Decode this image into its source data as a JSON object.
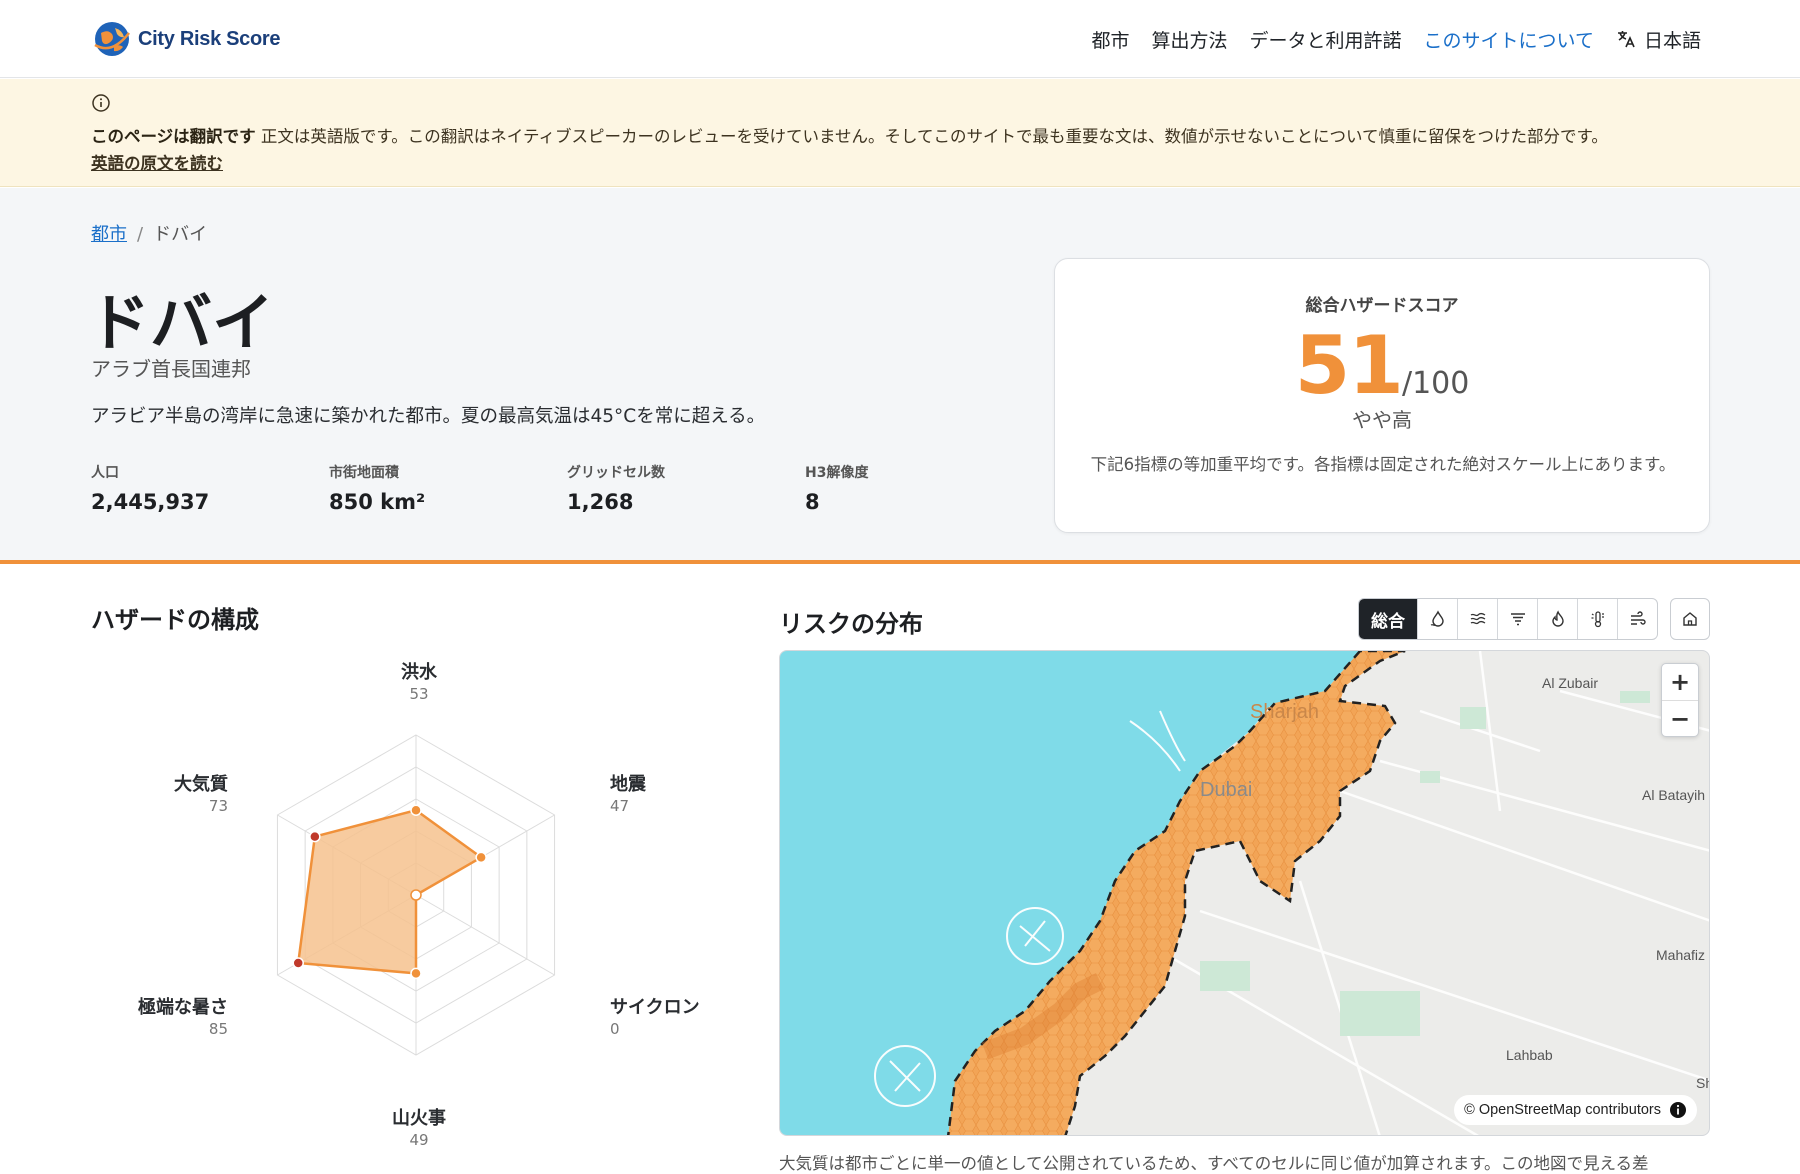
{
  "header": {
    "logo_text": "City Risk Score",
    "nav": [
      "都市",
      "算出方法",
      "データと利用許諾",
      "このサイトについて"
    ],
    "language": "日本語"
  },
  "notice": {
    "title": "このページは翻訳です",
    "message": "正文は英語版です。この翻訳はネイティブスピーカーのレビューを受けていません。そしてこのサイトで最も重要な文は、数値が示せないことについて慎重に留保をつけた部分です。",
    "link": "英語の原文を読む"
  },
  "breadcrumb": {
    "parent": "都市",
    "current": "ドバイ"
  },
  "city": {
    "name": "ドバイ",
    "country": "アラブ首長国連邦",
    "description": "アラビア半島の湾岸に急速に築かれた都市。夏の最高気温は45°Cを常に超える。",
    "stats": [
      {
        "label": "人口",
        "value": "2,445,937"
      },
      {
        "label": "市街地面積",
        "value": "850 km²"
      },
      {
        "label": "グリッドセル数",
        "value": "1,268"
      },
      {
        "label": "H3解像度",
        "value": "8"
      }
    ]
  },
  "score": {
    "label": "総合ハザードスコア",
    "value": "51",
    "denominator": "/100",
    "level": "やや高",
    "note": "下記6指標の等加重平均です。各指標は固定された絶対スケール上にあります。"
  },
  "composition": {
    "title": "ハザードの構成",
    "axes": [
      {
        "name": "洪水",
        "score": "53"
      },
      {
        "name": "地震",
        "score": "47"
      },
      {
        "name": "サイクロン",
        "score": "0"
      },
      {
        "name": "山火事",
        "score": "49"
      },
      {
        "name": "極端な暑さ",
        "score": "85"
      },
      {
        "name": "大気質",
        "score": "73"
      }
    ],
    "colors": {
      "stroke": "#f0913a",
      "fill": "#f6c28e",
      "high": "#c0392b",
      "mid": "#f0913a"
    }
  },
  "map": {
    "title": "リスクの分布",
    "active_layer": "総合",
    "layer_icons": [
      "flood-icon",
      "earthquake-icon",
      "cyclone-icon",
      "wildfire-icon",
      "heat-icon",
      "air-quality-icon"
    ],
    "labels": {
      "sharjah": "Sharjah",
      "dubai": "Dubai",
      "al_zubair": "Al Zubair",
      "al_batayih": "Al Batayih",
      "mahafiz": "Mahafiz",
      "lahbab": "Lahbab",
      "sh": "Sh"
    },
    "attribution": "© OpenStreetMap contributors",
    "caption": "大気質は都市ごとに単一の値として公開されているため、すべてのセルに同じ値が加算されます。この地図で見える差"
  }
}
